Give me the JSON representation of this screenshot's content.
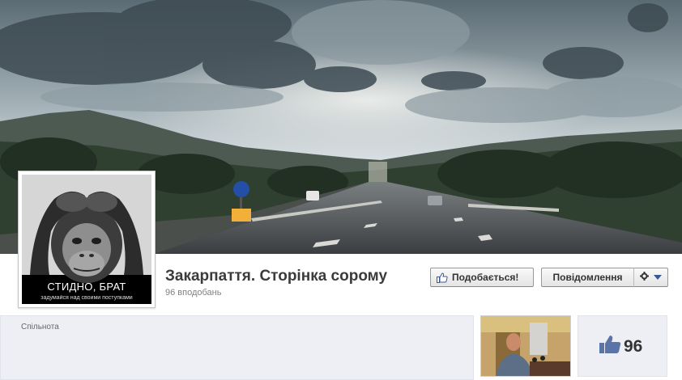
{
  "page": {
    "title": "Закарпаття. Сторінка сорому",
    "likes_line": "96 вподобань",
    "category": "Спільнота"
  },
  "profile": {
    "caption": "СТИДНО, БРАТ",
    "subcaption": "задумайся над своими поступками"
  },
  "actions": {
    "like_label": "Подобається!",
    "message_label": "Повідомлення",
    "settings_icon": "gear-icon",
    "settings_caret_icon": "caret-down-icon"
  },
  "likes_box": {
    "count": "96",
    "icon": "thumbs-up-icon"
  },
  "colors": {
    "brand_blue": "#3b5998",
    "panel_bg": "#edeff4",
    "button_bg": "#f2f2f2"
  }
}
